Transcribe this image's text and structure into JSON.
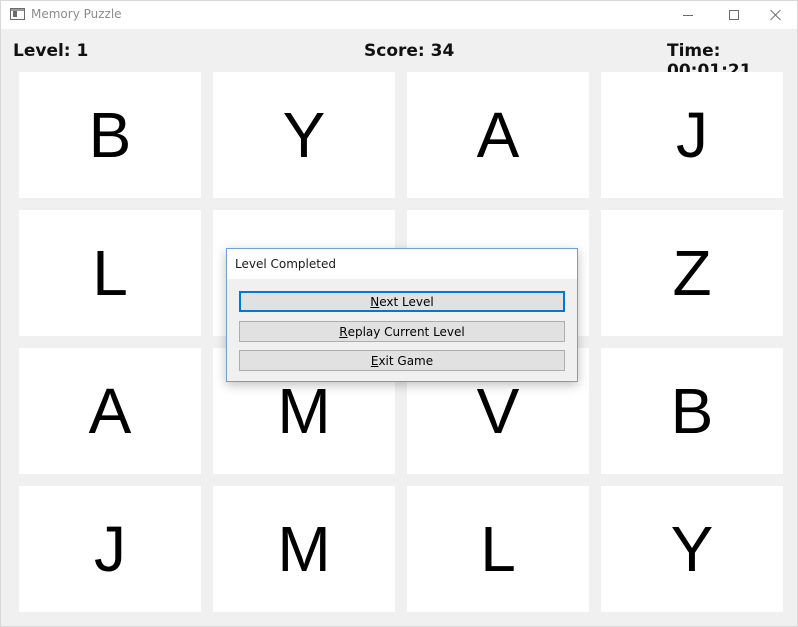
{
  "window": {
    "title": "Memory Puzzle"
  },
  "status": {
    "level": "Level: 1",
    "score": "Score: 34",
    "time": "Time: 00:01:21"
  },
  "cards": [
    "B",
    "Y",
    "A",
    "J",
    "L",
    "",
    "",
    "Z",
    "A",
    "M",
    "V",
    "B",
    "J",
    "M",
    "L",
    "Y"
  ],
  "dialog": {
    "title": "Level Completed",
    "buttons": [
      {
        "mnemonic": "N",
        "rest": "ext Level"
      },
      {
        "mnemonic": "R",
        "rest": "eplay Current Level"
      },
      {
        "mnemonic": "E",
        "rest": "xit Game"
      }
    ]
  }
}
